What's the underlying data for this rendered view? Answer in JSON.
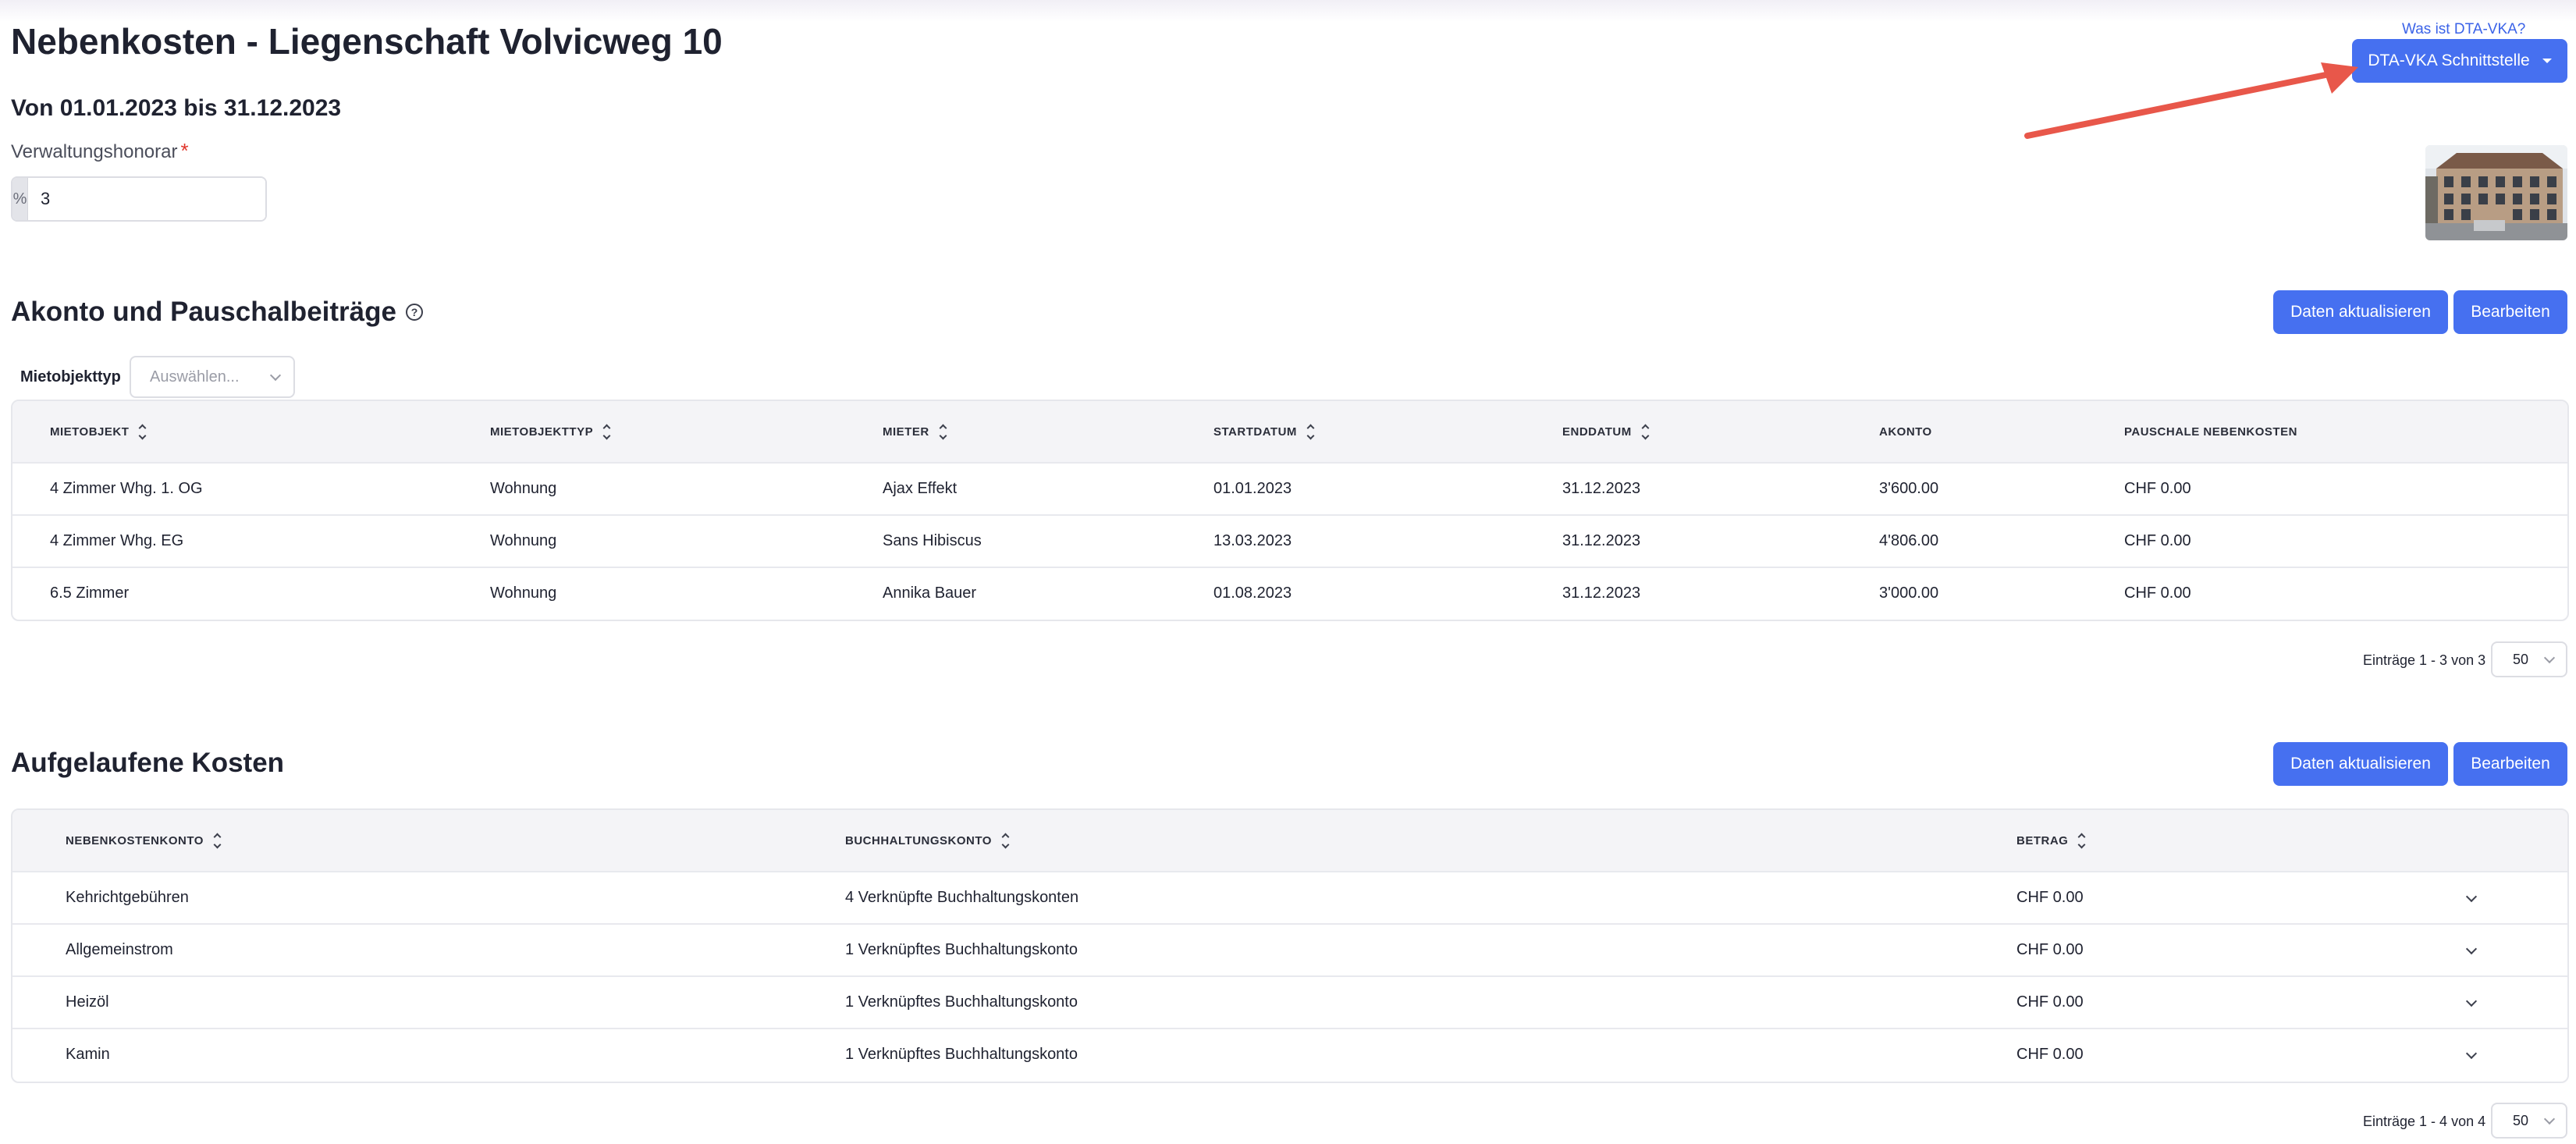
{
  "header": {
    "title": "Nebenkosten - Liegenschaft Volvicweg 10",
    "period": "Von 01.01.2023 bis 31.12.2023",
    "help_link": "Was ist DTA-VKA?",
    "dta_button": "DTA-VKA Schnittstelle"
  },
  "fee": {
    "label": "Verwaltungshonorar",
    "required_mark": "*",
    "addon": "%",
    "value": "3"
  },
  "akonto": {
    "title": "Akonto und Pauschalbeiträge",
    "help_icon": "?",
    "refresh_button": "Daten aktualisieren",
    "edit_button": "Bearbeiten",
    "filter_label": "Mietobjekttyp",
    "filter_placeholder": "Auswählen...",
    "columns": [
      "MIETOBJEKT",
      "MIETOBJEKTTYP",
      "MIETER",
      "STARTDATUM",
      "ENDDATUM",
      "AKONTO",
      "PAUSCHALE NEBENKOSTEN"
    ],
    "rows": [
      [
        "4 Zimmer Whg. 1. OG",
        "Wohnung",
        "Ajax Effekt",
        "01.01.2023",
        "31.12.2023",
        "3'600.00",
        "CHF 0.00"
      ],
      [
        "4 Zimmer Whg. EG",
        "Wohnung",
        "Sans Hibiscus",
        "13.03.2023",
        "31.12.2023",
        "4'806.00",
        "CHF 0.00"
      ],
      [
        "6.5 Zimmer",
        "Wohnung",
        "Annika Bauer",
        "01.08.2023",
        "31.12.2023",
        "3'000.00",
        "CHF 0.00"
      ]
    ],
    "pager_text": "Einträge 1 - 3 von 3",
    "page_size": "50"
  },
  "kosten": {
    "title": "Aufgelaufene Kosten",
    "refresh_button": "Daten aktualisieren",
    "edit_button": "Bearbeiten",
    "columns": [
      "NEBENKOSTENKONTO",
      "BUCHHALTUNGSKONTO",
      "BETRAG"
    ],
    "rows": [
      [
        "Kehrichtgebühren",
        "4 Verknüpfte Buchhaltungskonten",
        "CHF 0.00"
      ],
      [
        "Allgemeinstrom",
        "1 Verknüpftes Buchhaltungskonto",
        "CHF 0.00"
      ],
      [
        "Heizöl",
        "1 Verknüpftes Buchhaltungskonto",
        "CHF 0.00"
      ],
      [
        "Kamin",
        "1 Verknüpftes Buchhaltungskonto",
        "CHF 0.00"
      ]
    ],
    "pager_text": "Einträge 1 - 4 von 4",
    "page_size": "50"
  },
  "colors": {
    "primary": "#4670f0",
    "annotation_arrow": "#e8574a",
    "required": "#e0352b"
  },
  "icons": [
    "help-circle-icon",
    "sort-icon",
    "chevron-down-icon",
    "caret-down-icon",
    "annotation-arrow-icon",
    "building-photo"
  ]
}
